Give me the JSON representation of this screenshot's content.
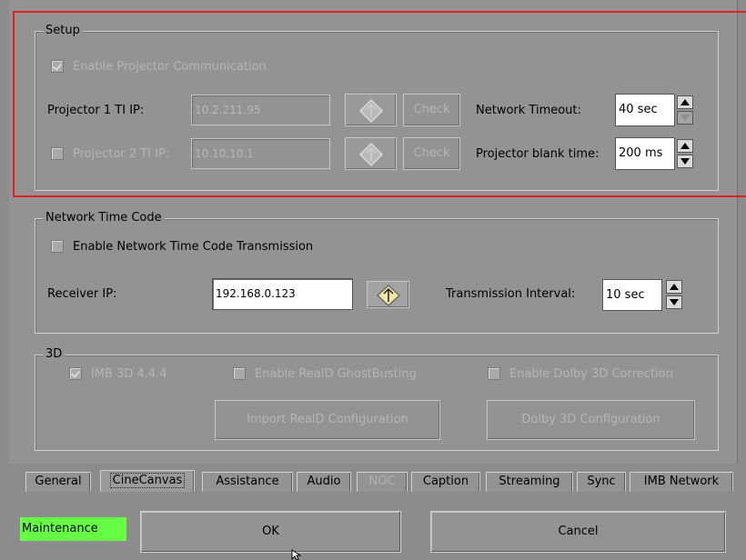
{
  "setup": {
    "title": "Setup",
    "enable_projector_comm": "Enable Projector Communication",
    "projector1_label": "Projector 1 TI IP:",
    "projector1_ip": "10.2.211.95",
    "projector2_label": "Projector 2 TI IP:",
    "projector2_ip": "10.10.10.1",
    "check_label": "Check",
    "network_timeout_label": "Network Timeout:",
    "network_timeout_value": "40 sec",
    "blank_time_label": "Projector blank time:",
    "blank_time_value": "200 ms"
  },
  "ntc": {
    "title": "Network Time Code",
    "enable_label": "Enable Network Time Code Transmission",
    "receiver_label": "Receiver IP:",
    "receiver_ip": "192.168.0.123",
    "interval_label": "Transmission Interval:",
    "interval_value": "10 sec"
  },
  "three_d": {
    "title": "3D",
    "imb_label": "IMB 3D 4.4.4",
    "reald_label": "Enable RealD GhostBusting",
    "dolby_label": "Enable Dolby 3D Correction",
    "import_reald": "Import RealD Configuration",
    "dolby_config": "Dolby 3D Configuration"
  },
  "tabs": [
    "General",
    "CineCanvas",
    "Assistance",
    "Audio",
    "NOC",
    "Caption",
    "Streaming",
    "Sync",
    "IMB Network"
  ],
  "footer": {
    "maintenance": "Maintenance",
    "ok": "OK",
    "cancel": "Cancel"
  },
  "colors": {
    "background": "#939393",
    "maintenance_badge": "#66ff44",
    "highlight_box": "#e0201f"
  }
}
